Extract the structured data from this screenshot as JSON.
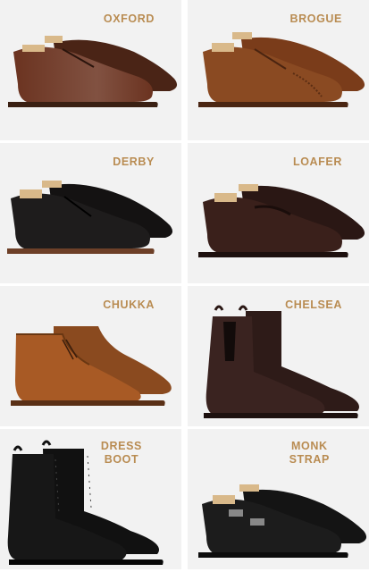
{
  "tiles": [
    {
      "name": "OXFORD",
      "color": "#6b3320"
    },
    {
      "name": "BROGUE",
      "color": "#8a4a22"
    },
    {
      "name": "DERBY",
      "color": "#1e1c1c"
    },
    {
      "name": "LOAFER",
      "color": "#3a201b"
    },
    {
      "name": "CHUKKA",
      "color": "#a85a25"
    },
    {
      "name": "CHELSEA",
      "color": "#3a2320"
    },
    {
      "name": "DRESS\nBOOT",
      "color": "#171717"
    },
    {
      "name": "MONK\nSTRAP",
      "color": "#1c1c1c"
    }
  ],
  "colors": {
    "label": "#b98c52",
    "tile_bg": "#f2f2f2",
    "shoe_tree": "#d9b98a",
    "sole": "#4a2d1f"
  }
}
